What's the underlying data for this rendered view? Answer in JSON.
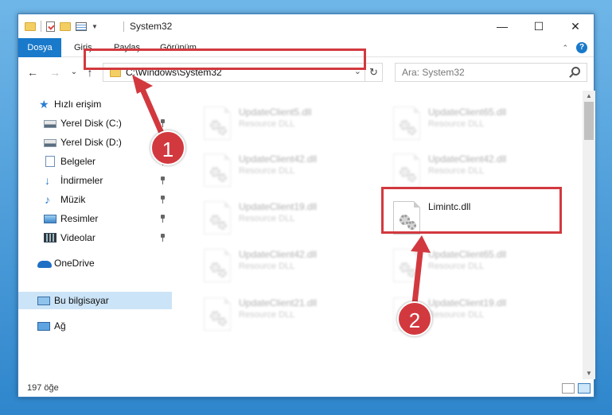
{
  "window": {
    "title": "System32",
    "controls": {
      "minimize": "—",
      "maximize": "☐",
      "close": "✕"
    }
  },
  "ribbon": {
    "tabs": [
      "Dosya",
      "Giriş",
      "Paylaş",
      "Görünüm"
    ],
    "expand": "⌄",
    "help": "?"
  },
  "nav": {
    "back": "←",
    "forward": "→",
    "recent": "⌄",
    "up": "↑",
    "address": "C:\\Windows\\System32",
    "address_dropdown": "⌄",
    "refresh": "↻",
    "search_placeholder": "Ara: System32"
  },
  "sidebar": {
    "items": [
      {
        "label": "Hızlı erişim",
        "icon": "star-icon"
      },
      {
        "label": "Yerel Disk (C:)",
        "icon": "drive-icon",
        "pinned": true
      },
      {
        "label": "Yerel Disk (D:)",
        "icon": "drive-icon"
      },
      {
        "label": "Belgeler",
        "icon": "documents-icon",
        "pinned": true
      },
      {
        "label": "İndirmeler",
        "icon": "downloads-icon",
        "pinned": true
      },
      {
        "label": "Müzik",
        "icon": "music-icon",
        "pinned": true
      },
      {
        "label": "Resimler",
        "icon": "pictures-icon",
        "pinned": true
      },
      {
        "label": "Videolar",
        "icon": "videos-icon",
        "pinned": true
      },
      {
        "label": "OneDrive",
        "icon": "onedrive-icon"
      },
      {
        "label": "Bu bilgisayar",
        "icon": "computer-icon",
        "selected": true
      },
      {
        "label": "Ağ",
        "icon": "network-icon"
      }
    ]
  },
  "files": [
    {
      "name": "UpdateClient5.dll",
      "type": "Resource DLL",
      "blurred": true
    },
    {
      "name": "UpdateClient65.dll",
      "type": "Resource DLL",
      "blurred": true
    },
    {
      "name": "UpdateClient42.dll",
      "type": "Resource DLL",
      "blurred": true
    },
    {
      "name": "UpdateClient42.dll",
      "type": "Resource DLL",
      "blurred": true
    },
    {
      "name": "UpdateClient19.dll",
      "type": "Resource DLL",
      "blurred": true
    },
    {
      "name": "Limintc.dll",
      "type": "",
      "blurred": false
    },
    {
      "name": "UpdateClient42.dll",
      "type": "Resource DLL",
      "blurred": true
    },
    {
      "name": "UpdateClient65.dll",
      "type": "Resource DLL",
      "blurred": true
    },
    {
      "name": "UpdateClient21.dll",
      "type": "Resource DLL",
      "blurred": true
    },
    {
      "name": "UpdateClient19.dll",
      "type": "Resource DLL",
      "blurred": true
    }
  ],
  "status": {
    "count": "197 öğe"
  },
  "annotations": {
    "step1": "1",
    "step2": "2",
    "color": "#d2393f"
  }
}
